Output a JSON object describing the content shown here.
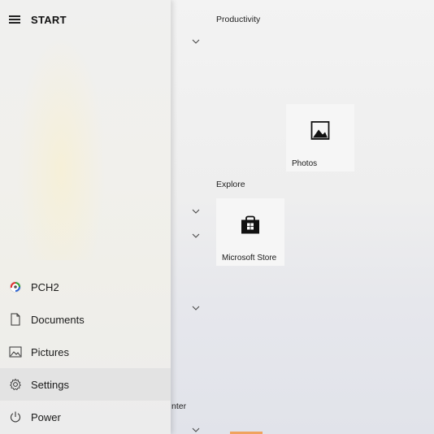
{
  "nav": {
    "title": "START",
    "items": [
      {
        "label": "PCH2",
        "icon": "pch2-app-icon"
      },
      {
        "label": "Documents",
        "icon": "document-icon"
      },
      {
        "label": "Pictures",
        "icon": "pictures-icon"
      },
      {
        "label": "Settings",
        "icon": "gear-icon"
      },
      {
        "label": "Power",
        "icon": "power-icon"
      }
    ]
  },
  "groups": {
    "productivity": "Productivity",
    "explore": "Explore",
    "partial": "nter"
  },
  "tiles": {
    "photos": "Photos",
    "store": "Microsoft Store"
  },
  "colors": {
    "accent_orange": "#f0a35e"
  }
}
